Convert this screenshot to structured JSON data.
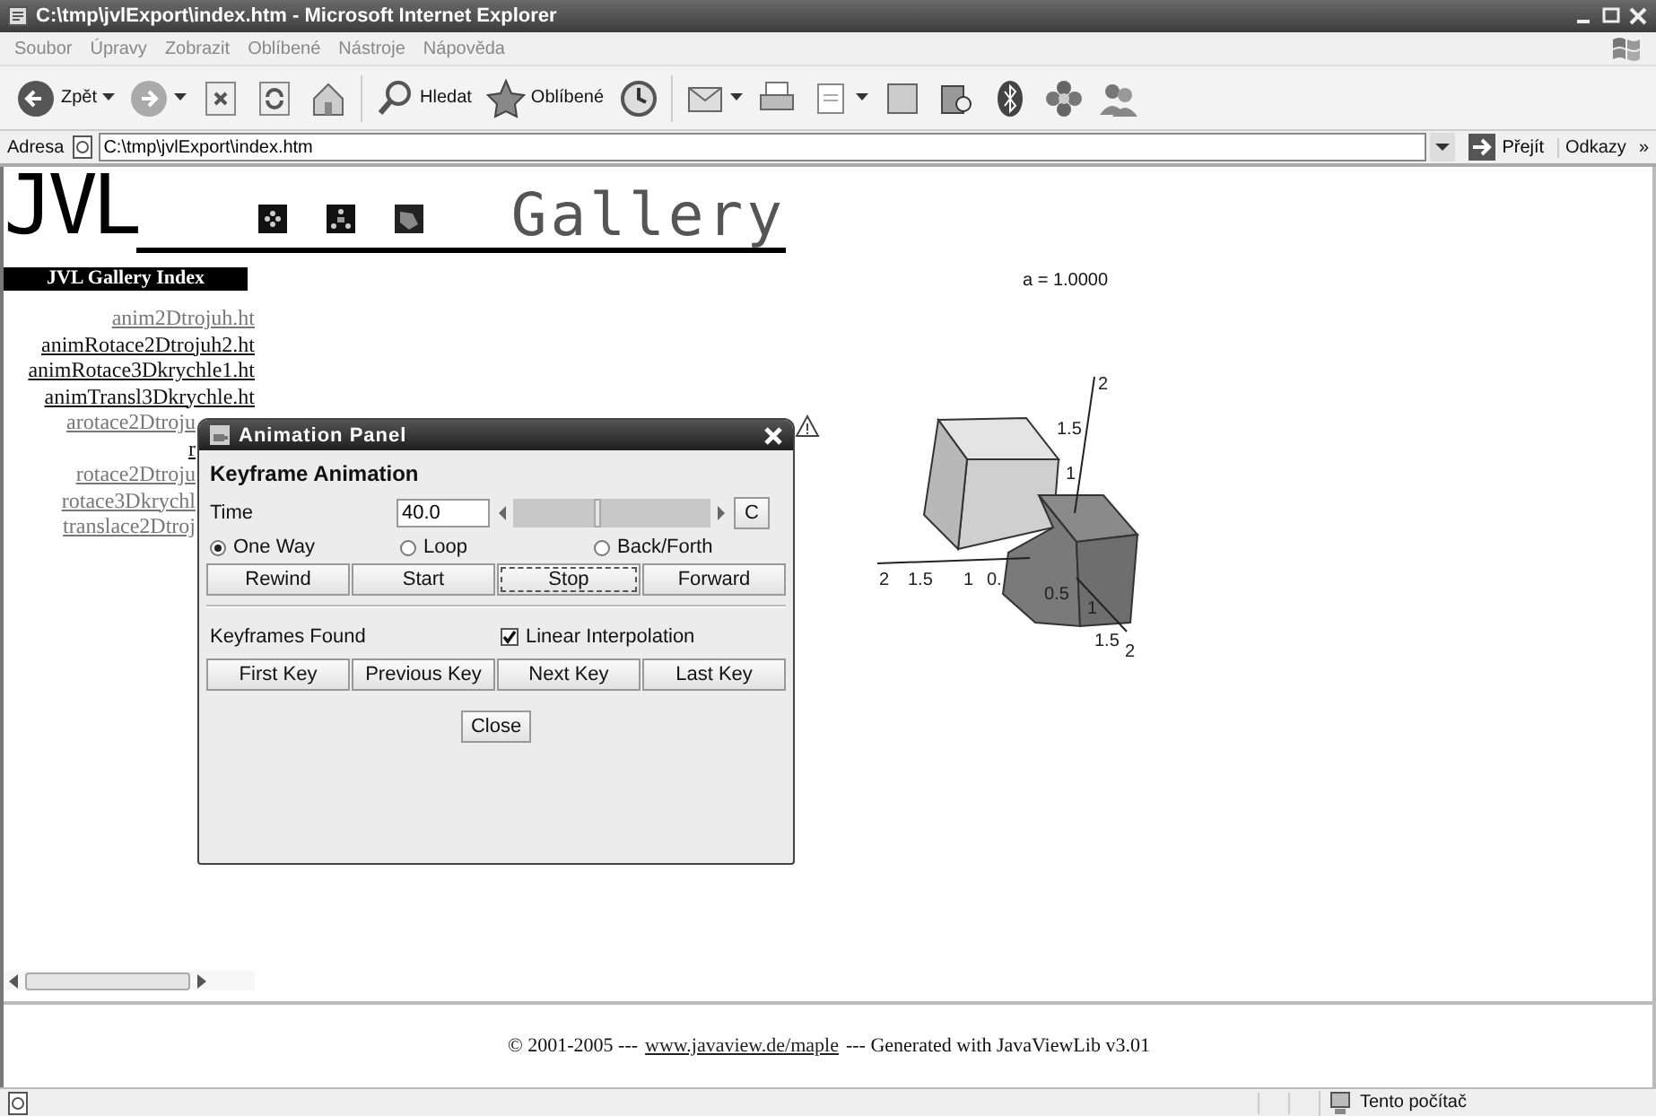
{
  "window": {
    "title": "C:\\tmp\\jvlExport\\index.htm - Microsoft Internet Explorer"
  },
  "menu": [
    "Soubor",
    "Úpravy",
    "Zobrazit",
    "Oblíbené",
    "Nástroje",
    "Nápověda"
  ],
  "toolbar": [
    {
      "kind": "back",
      "label": "Zpět",
      "dropdown": true
    },
    {
      "kind": "forward",
      "dropdown": true
    },
    {
      "kind": "stop",
      "dropdown": false
    },
    {
      "kind": "refresh",
      "dropdown": false
    },
    {
      "kind": "home",
      "dropdown": false
    },
    {
      "kind": "search",
      "label": "Hledat",
      "dropdown": false
    },
    {
      "kind": "favorites",
      "label": "Oblíbené",
      "dropdown": false
    },
    {
      "kind": "history",
      "dropdown": false
    },
    {
      "kind": "mail",
      "dropdown": true
    },
    {
      "kind": "print",
      "dropdown": false
    },
    {
      "kind": "edit",
      "dropdown": true
    },
    {
      "kind": "note",
      "dropdown": false
    },
    {
      "kind": "research",
      "dropdown": false
    },
    {
      "kind": "bluetooth",
      "dropdown": false
    },
    {
      "kind": "flower",
      "dropdown": false
    },
    {
      "kind": "messenger",
      "dropdown": false
    }
  ],
  "address_bar": {
    "label": "Adresa",
    "url": "C:\\tmp\\jvlExport\\index.htm",
    "go": "Přejít",
    "links": "Odkazy",
    "more": "»"
  },
  "page": {
    "logo": "JVL",
    "title": "Gallery",
    "index_title": "JVL Gallery Index",
    "links": [
      {
        "label": "anim2Dtrojuh.ht",
        "visited": true
      },
      {
        "label": "animRotace2Dtrojuh2.ht",
        "visited": false
      },
      {
        "label": "animRotace3Dkrychle1.ht",
        "visited": false
      },
      {
        "label": "animTransl3Dkrychle.ht",
        "visited": false
      }
    ],
    "partly_hidden_links": [
      {
        "label": "arotace2Dtroju",
        "visited": true
      },
      {
        "label": "r",
        "visited": false
      },
      {
        "label": "rotace2Dtroju",
        "visited": true
      },
      {
        "label": "rotace3Dkrychl",
        "visited": true
      },
      {
        "label": "translace2Dtroj",
        "visited": true
      }
    ],
    "plot": {
      "label": "a = 1.0000",
      "x_ticks": [
        "2",
        "1.5",
        "1",
        "0."
      ],
      "z_ticks": [
        "2",
        "1.5",
        "1"
      ],
      "y_ticks": [
        "0.5",
        "1",
        "1.5",
        "2"
      ]
    },
    "footer": {
      "before": "© 2001-2005 ---",
      "link": "www.javaview.de/maple",
      "after": "--- Generated with JavaViewLib v3.01"
    }
  },
  "dialog": {
    "title": "Animation Panel",
    "heading": "Keyframe Animation",
    "time_label": "Time",
    "time_value": "40.0",
    "level": 0.41,
    "clear_button": "C",
    "modes": [
      {
        "label": "One Way",
        "selected": true
      },
      {
        "label": "Loop",
        "selected": false
      },
      {
        "label": "Back/Forth",
        "selected": false
      }
    ],
    "transport": [
      {
        "label": "Rewind",
        "focused": false
      },
      {
        "label": "Start",
        "focused": false
      },
      {
        "label": "Stop",
        "focused": true
      },
      {
        "label": "Forward",
        "focused": false
      }
    ],
    "keyframes_label": "Keyframes Found",
    "interpolation": {
      "label": "Linear Interpolation",
      "checked": true
    },
    "key_buttons": [
      "First Key",
      "Previous Key",
      "Next Key",
      "Last Key"
    ],
    "close": "Close"
  },
  "status_bar": {
    "zone": "Tento počítač"
  }
}
